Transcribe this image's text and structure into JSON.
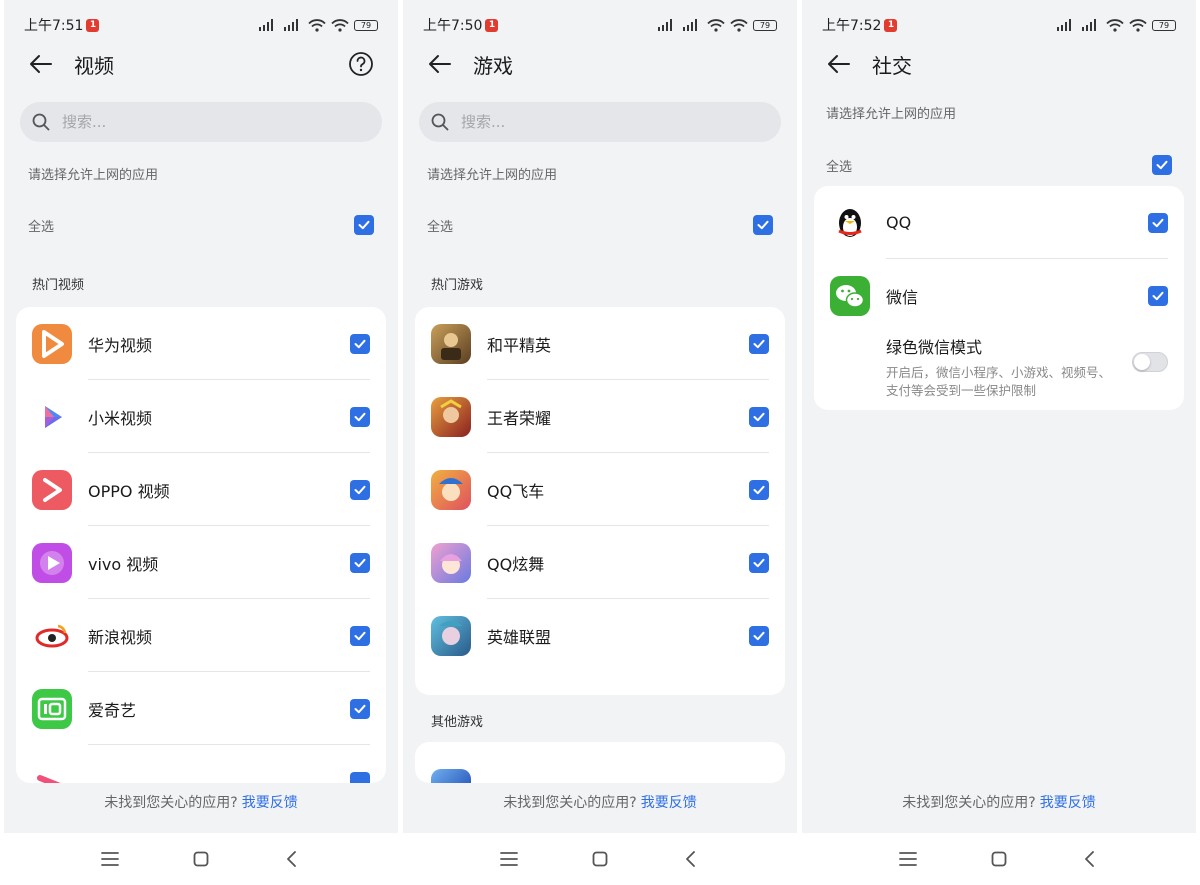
{
  "colors": {
    "accent": "#2f6fe4",
    "background": "#f1f3f5",
    "card": "#ffffff"
  },
  "screens": [
    {
      "time": "上午7:51",
      "notif": "1",
      "battery": "79",
      "title": "视频",
      "search_placeholder": "搜索...",
      "hint": "请选择允许上网的应用",
      "select_all": "全选",
      "section": "热门视频",
      "apps": [
        {
          "name": "华为视频",
          "icon": "huawei-video-icon",
          "color": "#f08a3e"
        },
        {
          "name": "小米视频",
          "icon": "xiaomi-video-icon",
          "color": "#ffffff"
        },
        {
          "name": "OPPO 视频",
          "icon": "oppo-video-icon",
          "color": "#ee5a62"
        },
        {
          "name": "vivo 视频",
          "icon": "vivo-video-icon",
          "color": "#c04de6"
        },
        {
          "name": "新浪视频",
          "icon": "sina-video-icon",
          "color": "#ffffff"
        },
        {
          "name": "爱奇艺",
          "icon": "iqiyi-icon",
          "color": "#3dc846"
        }
      ],
      "footer_text": "未找到您关心的应用?",
      "footer_link": "我要反馈"
    },
    {
      "time": "上午7:50",
      "notif": "1",
      "battery": "79",
      "title": "游戏",
      "search_placeholder": "搜索...",
      "hint": "请选择允许上网的应用",
      "select_all": "全选",
      "section": "热门游戏",
      "apps": [
        {
          "name": "和平精英",
          "icon": "peacekeeper-elite-icon",
          "color": "#8a6a3a"
        },
        {
          "name": "王者荣耀",
          "icon": "honor-of-kings-icon",
          "color": "#c0463a"
        },
        {
          "name": "QQ飞车",
          "icon": "qq-speed-icon",
          "color": "#e9864a"
        },
        {
          "name": "QQ炫舞",
          "icon": "qq-dance-icon",
          "color": "#9a7ad6"
        },
        {
          "name": "英雄联盟",
          "icon": "league-of-legends-icon",
          "color": "#4aa0b8"
        }
      ],
      "section2": "其他游戏",
      "footer_text": "未找到您关心的应用?",
      "footer_link": "我要反馈"
    },
    {
      "time": "上午7:52",
      "notif": "1",
      "battery": "79",
      "title": "社交",
      "hint": "请选择允许上网的应用",
      "select_all": "全选",
      "apps": [
        {
          "name": "QQ",
          "icon": "qq-penguin-icon",
          "color": "#ffffff"
        },
        {
          "name": "微信",
          "icon": "wechat-icon",
          "color": "#3cb034"
        }
      ],
      "green_mode_title": "绿色微信模式",
      "green_mode_desc": "开启后，微信小程序、小游戏、视频号、支付等会受到一些保护限制",
      "footer_text": "未找到您关心的应用?",
      "footer_link": "我要反馈"
    }
  ]
}
